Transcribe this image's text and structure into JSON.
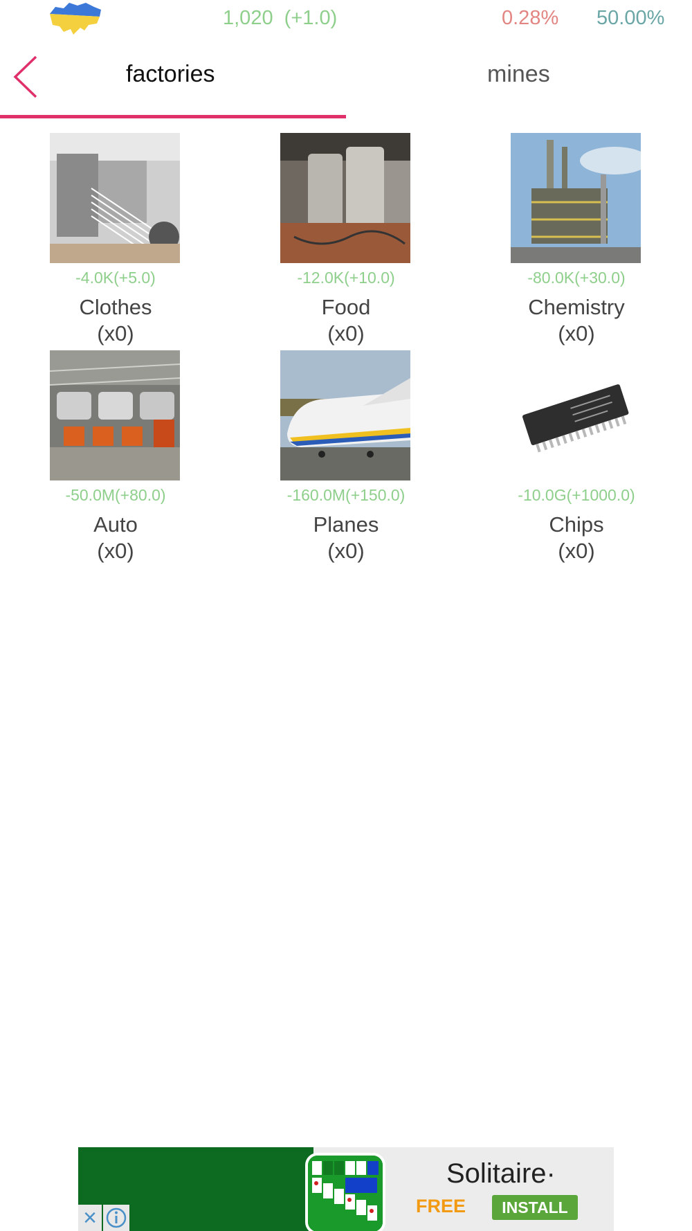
{
  "status_bar": {
    "flag_icon": "ukraine-map-flag-icon",
    "flag_colors": [
      "#3c78d8",
      "#f4d03f"
    ],
    "money": "1,020  (+1.0)",
    "percent_red": "0.28%",
    "percent_teal": "50.00%"
  },
  "nav": {
    "back_icon": "chevron-left-icon",
    "accent_color": "#e0306a",
    "tabs": [
      {
        "label": "factories",
        "active": true
      },
      {
        "label": "mines",
        "active": false
      }
    ]
  },
  "items": [
    {
      "cost": "-4.0K(+5.0)",
      "name": "Clothes",
      "count": "(x0)",
      "image": "textile-loom-photo"
    },
    {
      "cost": "-12.0K(+10.0)",
      "name": "Food",
      "count": "(x0)",
      "image": "food-tanks-photo"
    },
    {
      "cost": "-80.0K(+30.0)",
      "name": "Chemistry",
      "count": "(x0)",
      "image": "chemical-plant-photo"
    },
    {
      "cost": "-50.0M(+80.0)",
      "name": "Auto",
      "count": "(x0)",
      "image": "car-assembly-line-photo"
    },
    {
      "cost": "-160.0M(+150.0)",
      "name": "Planes",
      "count": "(x0)",
      "image": "cargo-airplane-photo"
    },
    {
      "cost": "-10.0G(+1000.0)",
      "name": "Chips",
      "count": "(x0)",
      "image": "microchip-photo"
    }
  ],
  "ad": {
    "title": "Solitaire·",
    "free_label": "FREE",
    "install_label": "INSTALL",
    "close_icon": "close-icon",
    "info_icon": "info-icon"
  }
}
